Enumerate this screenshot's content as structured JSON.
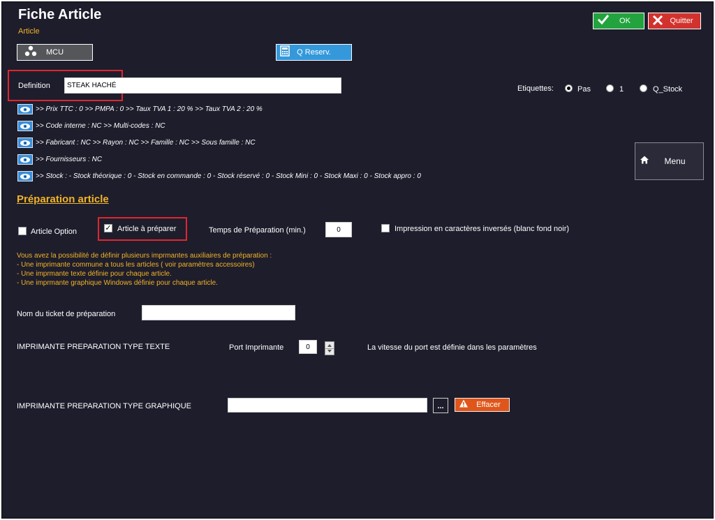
{
  "window": {
    "title": "Fiche Article",
    "subtitle": "Article"
  },
  "toolbar": {
    "ok_label": "OK",
    "quit_label": "Quitter",
    "mcu_label": "MCU",
    "qreserv_label": "Q Reserv.",
    "menu_label": "Menu"
  },
  "definition": {
    "label": "Definition",
    "value": "STEAK HACHÉ"
  },
  "etiquettes": {
    "label": "Etiquettes:",
    "options": [
      {
        "label": "Pas",
        "selected": true
      },
      {
        "label": "1",
        "selected": false
      },
      {
        "label": "Q_Stock",
        "selected": false
      }
    ]
  },
  "info_lines": [
    ">> Prix TTC : 0 >> PMPA : 0 >> Taux TVA 1 : 20 % >> Taux TVA 2 : 20 %",
    ">> Code interne : NC >> Multi-codes : NC",
    ">> Fabricant : NC >> Rayon : NC >> Famille : NC >> Sous famille : NC",
    ">> Fournisseurs : NC",
    ">> Stock : - Stock théorique : 0 - Stock en commande : 0 - Stock réservé : 0 - Stock Mini : 0 - Stock Maxi : 0 - Stock appro : 0"
  ],
  "preparation": {
    "section_title": "Préparation article",
    "article_option_label": "Article Option",
    "article_option_checked": false,
    "article_a_preparer_label": "Article à préparer",
    "article_a_preparer_checked": true,
    "temps_label": "Temps de Préparation (min.)",
    "temps_value": "0",
    "impression_label": "Impression en caractères inversés (blanc fond noir)",
    "impression_checked": false,
    "note": "Vous avez la possibilité de définir plusieurs imprmantes auxiliaires de préparation :\n- Une imprimante commune a tous les articles ( voir paramètres accessoires)\n- Une imprmante texte définie pour chaque article.\n- Une imprmante graphique Windows définie pour chaque article.",
    "ticket_label": "Nom du ticket de préparation",
    "ticket_value": "",
    "printer_text_label": "IMPRIMANTE PREPARATION TYPE TEXTE",
    "port_label": "Port Imprimante",
    "port_value": "0",
    "port_note": "La vitesse du port est définie dans les paramètres",
    "printer_graphic_label": "IMPRIMANTE PREPARATION TYPE GRAPHIQUE",
    "printer_graphic_value": "",
    "browse_label": "...",
    "effacer_label": "Effacer"
  },
  "colors": {
    "background": "#1e1d2c",
    "accent": "#f0b428",
    "ok": "#22a33e",
    "quit": "#d2322d",
    "info": "#3498db",
    "effacer": "#e0561a",
    "highlight": "#e0262f"
  }
}
